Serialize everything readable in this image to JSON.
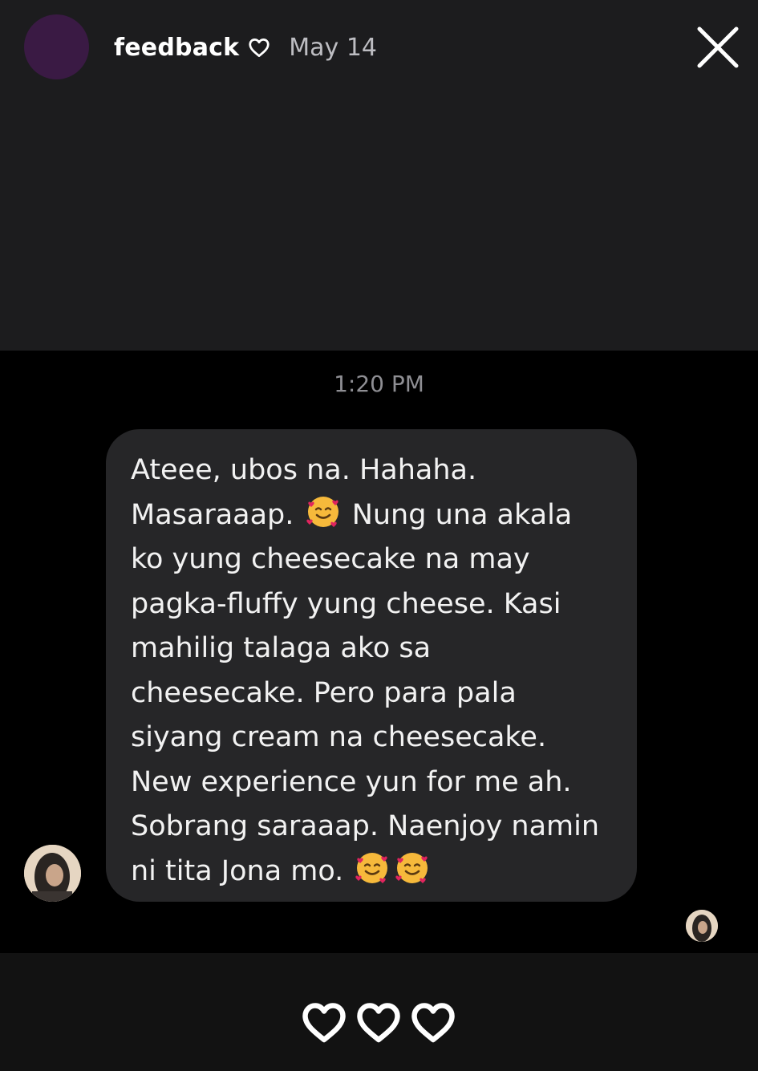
{
  "story": {
    "name": "feedback",
    "date": "May 14",
    "avatar_color": "#3a1a44",
    "heart_icon": "heart-outline-icon",
    "close_icon": "close-icon"
  },
  "chat": {
    "timestamp": "1:20 PM",
    "message_lines": [
      "Ateee, ubos na. Hahaha.",
      "Masaraaap.",
      "Nung una akala",
      "ko yung cheesecake na may",
      "pagka-fluffy yung cheese. Kasi",
      "mahilig talaga ako sa",
      "cheesecake. Pero para pala",
      "siyang cream na cheesecake.",
      "New experience yun for me ah.",
      "Sobrang saraaap. Naenjoy namin",
      "ni tita Jona mo."
    ],
    "emoji": "smiling-face-with-hearts",
    "bubble_color": "#262628"
  },
  "reactions": {
    "icons": [
      "heart-outline-icon",
      "heart-outline-icon",
      "heart-outline-icon"
    ]
  }
}
